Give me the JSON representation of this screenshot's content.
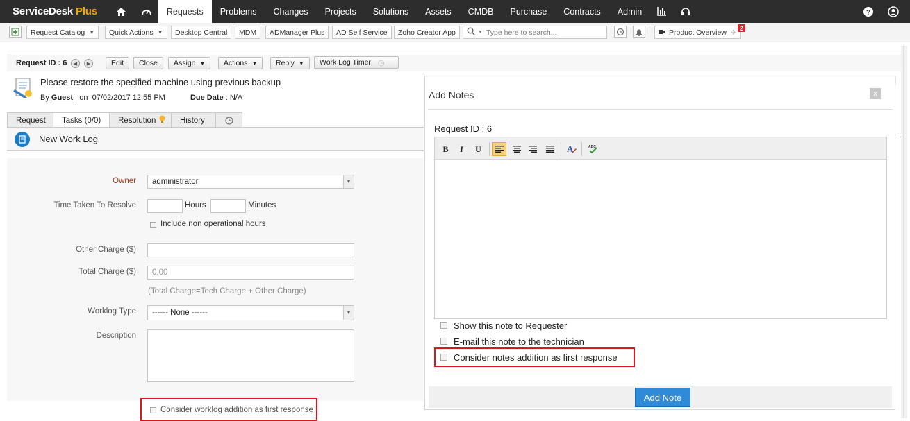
{
  "topnav": {
    "logo_main": "ServiceDesk",
    "logo_plus": " Plus",
    "items": [
      {
        "label": "Requests",
        "active": true
      },
      {
        "label": "Problems"
      },
      {
        "label": "Changes"
      },
      {
        "label": "Projects"
      },
      {
        "label": "Solutions"
      },
      {
        "label": "Assets"
      },
      {
        "label": "CMDB"
      },
      {
        "label": "Purchase"
      },
      {
        "label": "Contracts"
      },
      {
        "label": "Admin"
      }
    ]
  },
  "toolbar2": {
    "request_catalog": "Request Catalog",
    "quick_actions": "Quick Actions",
    "desktop_central": "Desktop Central",
    "mdm": "MDM",
    "admanager": "ADManager Plus",
    "ad_self_service": "AD Self Service",
    "zoho_creator": "Zoho Creator App",
    "search_placeholder": "Type here to search...",
    "product_overview": "Product Overview",
    "badge_count": "2"
  },
  "request": {
    "id_label": "Request ID : 6",
    "buttons": {
      "edit": "Edit",
      "close": "Close",
      "assign": "Assign",
      "actions": "Actions",
      "reply": "Reply",
      "worklog_timer": "Work Log Timer"
    },
    "subject": "Please restore the specified machine using previous backup",
    "by": "By",
    "requester": "Guest",
    "on": "on",
    "created": "07/02/2017 12:55 PM",
    "due_label": "Due Date",
    "due_value": ": N/A"
  },
  "tabs": [
    "Request",
    "Tasks (0/0)",
    "Resolution",
    "History"
  ],
  "worklog": {
    "title": "New Work Log",
    "owner_label": "Owner",
    "owner_value": "administrator",
    "time_label": "Time Taken To Resolve",
    "hours": "Hours",
    "minutes": "Minutes",
    "non_operational": "Include non operational hours",
    "other_charge_label": "Other Charge ($)",
    "total_charge_label": "Total Charge ($)",
    "total_charge_placeholder": "0.00",
    "charge_hint": "(Total Charge=Tech Charge + Other Charge)",
    "worklog_type_label": "Worklog Type",
    "worklog_type_value": "------ None ------",
    "description_label": "Description",
    "first_response": "Consider worklog addition as first response"
  },
  "dialog": {
    "title": "Add Notes",
    "close": "x",
    "request_id": "Request ID : 6",
    "show_to_requester": "Show this note to Requester",
    "email_technician": "E-mail this note to the technician",
    "first_response": "Consider notes addition as first response",
    "add_button": "Add Note"
  },
  "colors": {
    "accent": "#2f8ad7",
    "highlight": "#e0141e",
    "nav_bg": "#2d2d2d"
  }
}
